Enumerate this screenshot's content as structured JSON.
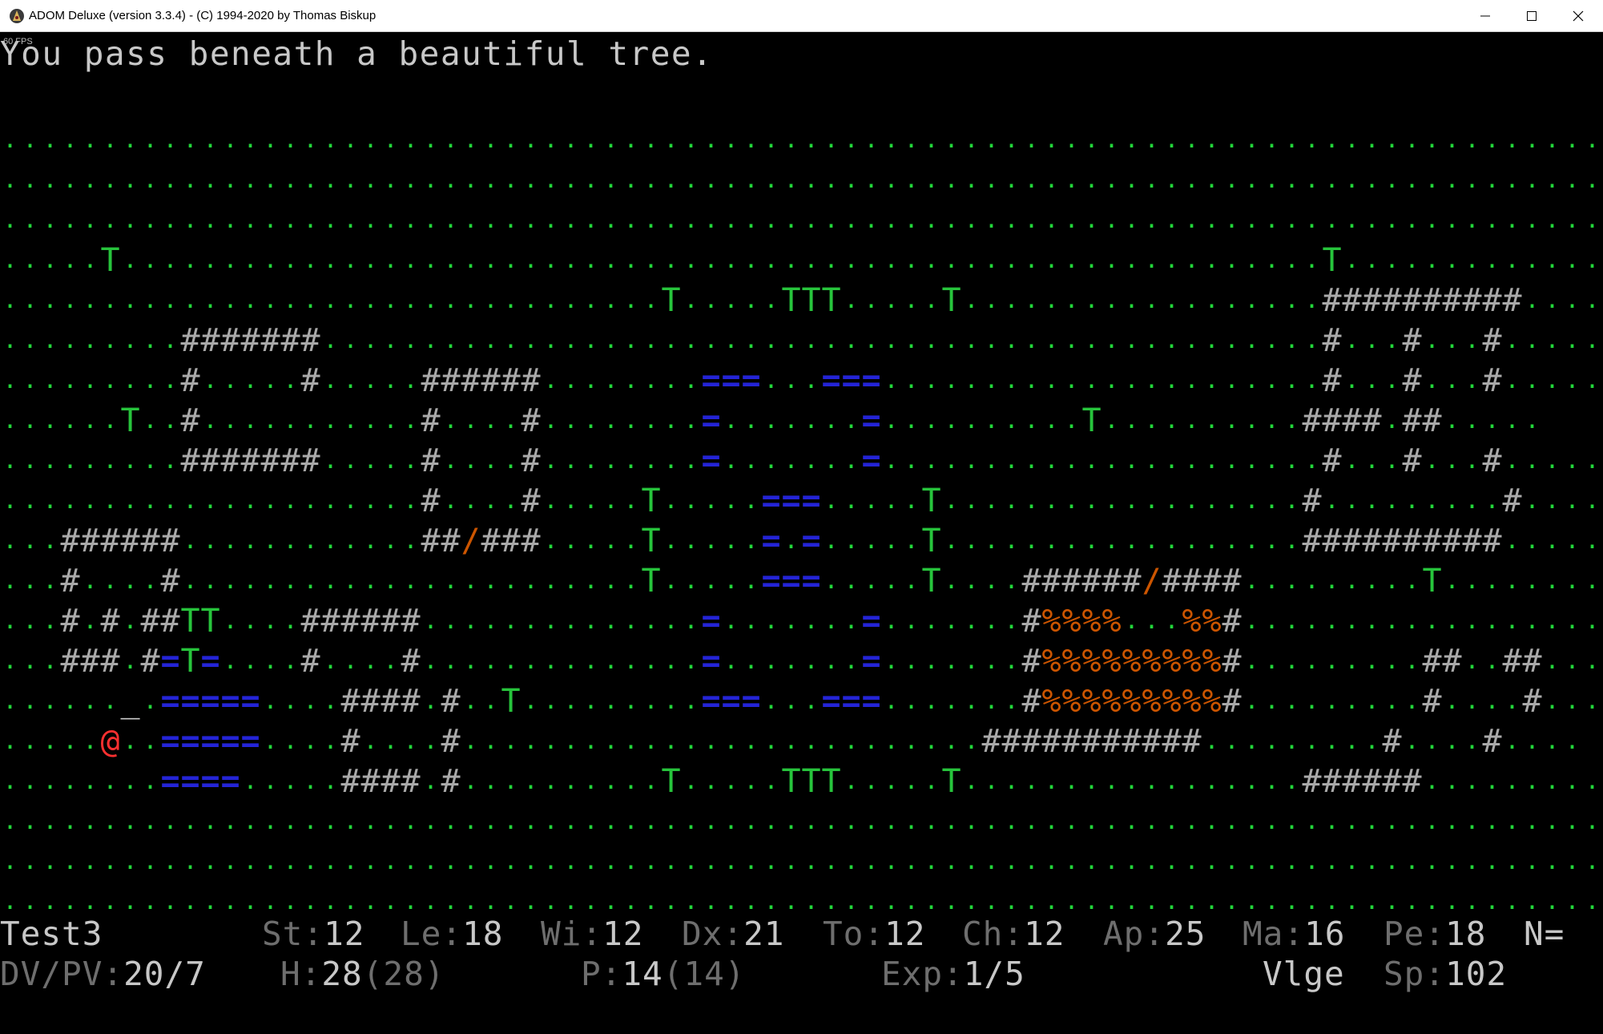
{
  "window": {
    "title": "ADOM Deluxe (version 3.3.4) - (C) 1994-2020 by Thomas Biskup",
    "icon": "adom-app-icon",
    "controls": [
      "minimize-icon",
      "maximize-icon",
      "close-icon"
    ]
  },
  "fps_label": "60 FPS",
  "message": "You pass beneath a beautiful tree.",
  "map": {
    "legend": {
      ".": "grass",
      "T": "tree",
      "#": "wall",
      "=": "water",
      "/": "open-door",
      "%": "mud",
      "@": "player",
      "_": "stair-marker"
    },
    "colors": {
      "grass": "#22d63a",
      "tree": "#27c43c",
      "wall": "#a9a9a9",
      "water": "#2424d6",
      "door": "#cc5500",
      "mud": "#cc5500",
      "player": "#ff3030"
    },
    "rows": [
      "................................................................................",
      "................................................................................",
      "................................................................................",
      ".....T............................................................T.............",
      ".................................T.....TTT.....T..................##########.....",
      ".........#######..................................................#...#...#.....",
      ".........#.....#.....######........===...===......................#...#...#.....",
      "......T..#...........#....#........=.......=..........T..........####.##.....",
      ".........#######.....#....#........=.......=......................#...#...#.....",
      ".....................#....#.....T.....===.....T..................#.........#.....",
      "...######............##/###.....T.....=.=.....T..................##########.....",
      "...#....#.......................T.....===.....T....######/####.........T.........",
      "...#.#.##TT....######..............=.......=.......#%%%%...%%#..................",
      "...###.#=T=....#....#..............=.......=.......#%%%%%%%%%#.........##..##....",
      "......_.=====....####.#..T.........===...===.......#%%%%%%%%%#.........#....#....",
      ".....@..=====....#....#..........................###########.........#....#....",
      "........====.....####.#..........T.....TTT.....T.................######..........",
      "................................................................................",
      "................................................................................",
      "................................................................................"
    ]
  },
  "stats": {
    "name": "Test3",
    "st_label": "St:",
    "st": "12",
    "le_label": "Le:",
    "le": "18",
    "wi_label": "Wi:",
    "wi": "12",
    "dx_label": "Dx:",
    "dx": "21",
    "to_label": "To:",
    "to": "12",
    "ch_label": "Ch:",
    "ch": "12",
    "ap_label": "Ap:",
    "ap": "25",
    "ma_label": "Ma:",
    "ma": "16",
    "pe_label": "Pe:",
    "pe": "18",
    "alignment": "N=",
    "dvpv_label": "DV/PV:",
    "dvpv": "20/7",
    "h_label": "H:",
    "h": "28",
    "h_max": "(28)",
    "p_label": "P:",
    "p": "14",
    "p_max": "(14)",
    "exp_label": "Exp:",
    "exp": "1/5",
    "location": "Vlge",
    "sp_label": "Sp:",
    "sp": "102"
  }
}
